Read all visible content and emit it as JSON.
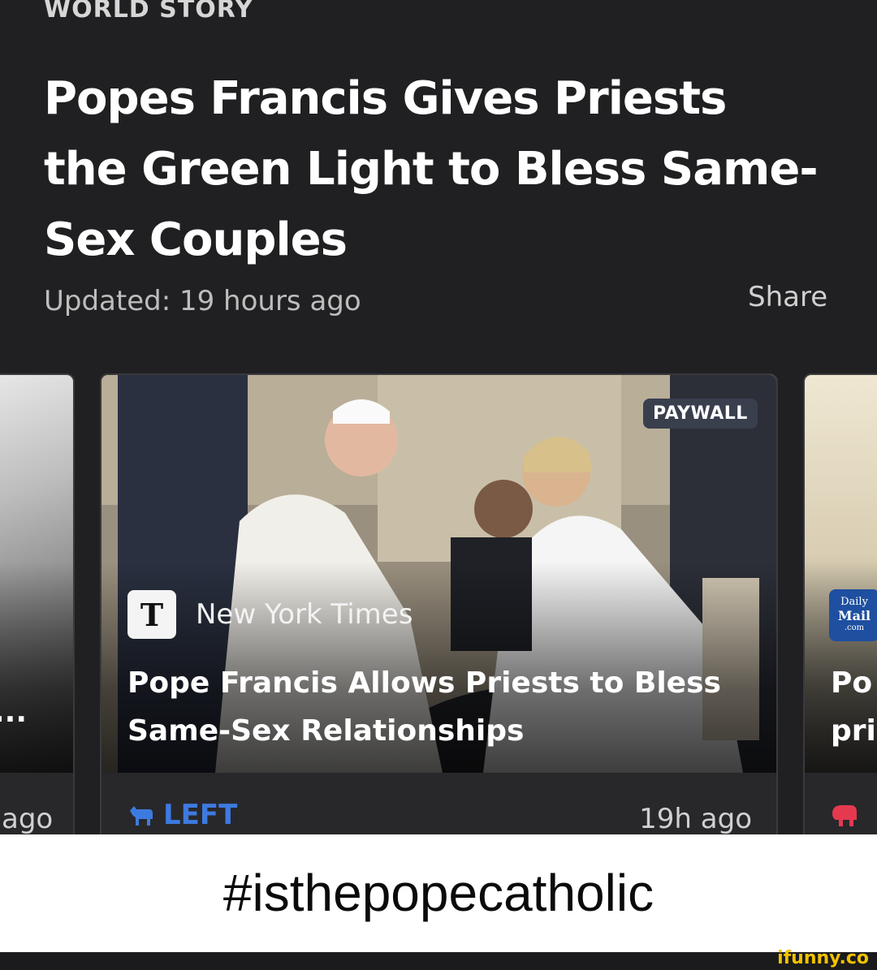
{
  "section": {
    "label": "WORLD STORY"
  },
  "story": {
    "headline": "Popes Francis Gives Priests the Green Light to Bless Same-Sex Couples",
    "updated": "Updated: 19 hours ago",
    "share_label": "Share"
  },
  "cards": {
    "left": {
      "title_tail": "...",
      "time": "ago"
    },
    "main": {
      "badge": "PAYWALL",
      "source_logo": "T",
      "source_name": "New York Times",
      "title": "Pope Francis Allows Priests to Bless Same-Sex Relationships",
      "bias_icon": "donkey-icon",
      "bias_label": "LEFT",
      "bias_color": "#3d7ae0",
      "time": "19h ago"
    },
    "right": {
      "source_logo_lines": [
        "Daily",
        "Mail",
        ".com"
      ],
      "title_lines": [
        "Po",
        "pri"
      ],
      "bias_icon": "elephant-icon",
      "bias_color": "#e53950"
    }
  },
  "caption": {
    "hashtag": "#isthepopecatholic"
  },
  "watermark": {
    "text": "ifunny.co"
  }
}
